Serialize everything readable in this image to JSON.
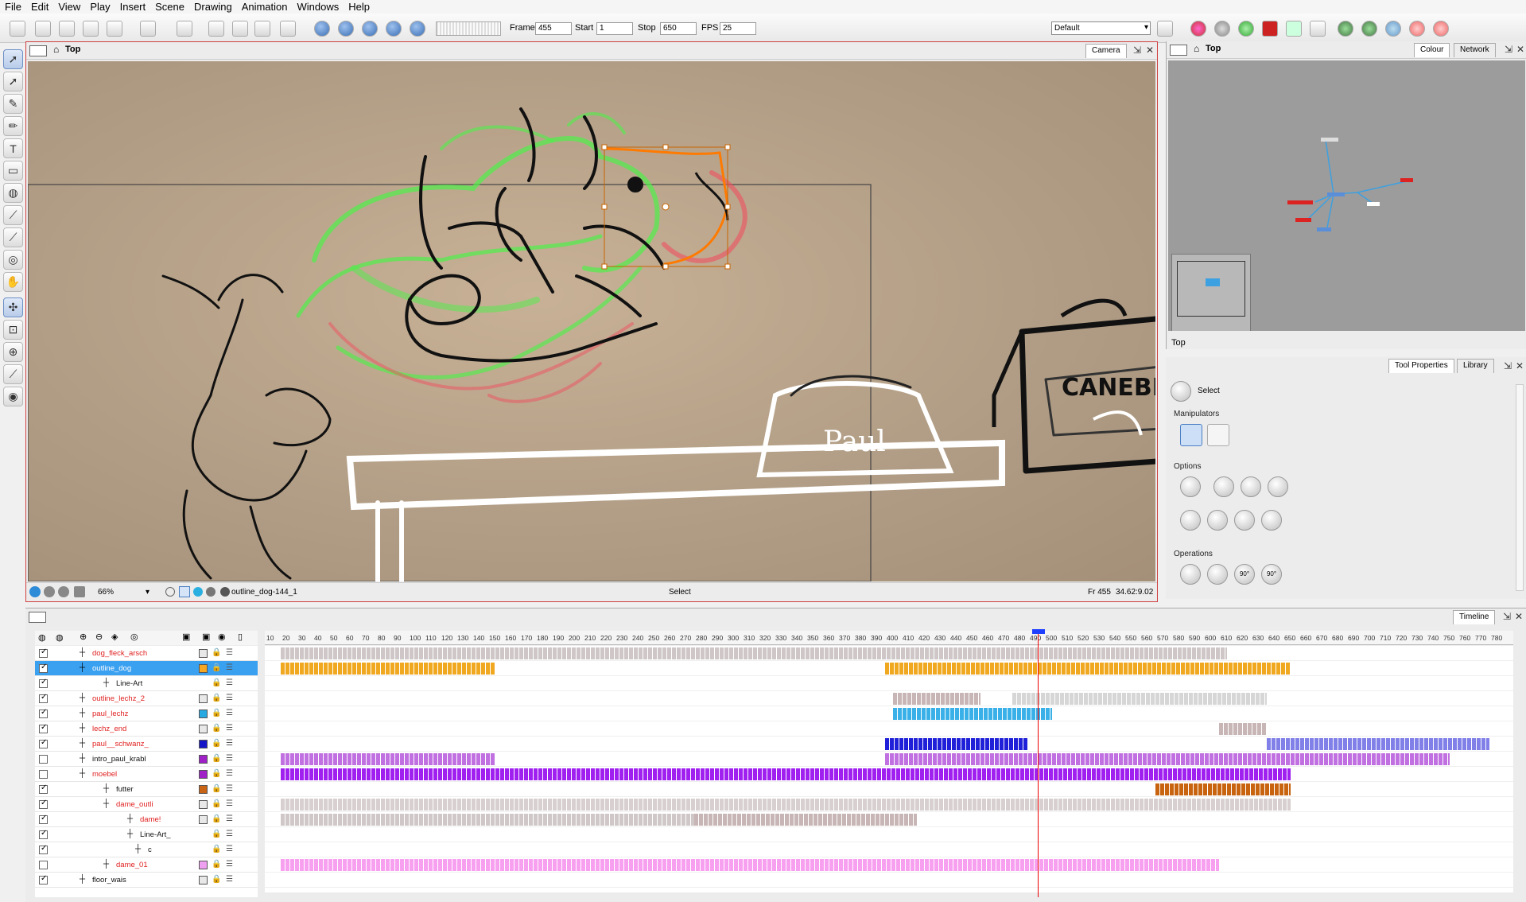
{
  "menu": [
    "File",
    "Edit",
    "View",
    "Play",
    "Insert",
    "Scene",
    "Drawing",
    "Animation",
    "Windows",
    "Help"
  ],
  "toolbar": {
    "frame_label": "Frame",
    "frame_value": "455",
    "start_label": "Start",
    "start_value": "1",
    "stop_label": "Stop",
    "stop_value": "650",
    "fps_label": "FPS",
    "fps_value": "25",
    "workspace": "Default"
  },
  "camera": {
    "view_name": "Top",
    "tab": "Camera",
    "zoom": "66%",
    "drawing_name": "outline_dog-144_1",
    "tool_status": "Select",
    "frame_readout": "Fr 455",
    "coords": "34.62:9.02",
    "box_label": "CANEBIO",
    "bowl_label": "Paul"
  },
  "network": {
    "view_name": "Top",
    "tabs": [
      "Colour",
      "Network"
    ],
    "navigator_label": "Top"
  },
  "tool_properties": {
    "tabs": [
      "Tool Properties",
      "Library"
    ],
    "tool_name": "Select",
    "sections": [
      "Manipulators",
      "Options",
      "Operations"
    ],
    "operation_labels": [
      "90°",
      "90°"
    ]
  },
  "timeline": {
    "tab": "Timeline",
    "ruler": [
      "10",
      "20",
      "30",
      "40",
      "50",
      "60",
      "70",
      "80",
      "90",
      "100",
      "110",
      "120",
      "130",
      "140",
      "150",
      "160",
      "170",
      "180",
      "190",
      "200",
      "210",
      "220",
      "230",
      "240",
      "250",
      "260",
      "270",
      "280",
      "290",
      "300",
      "310",
      "320",
      "330",
      "340",
      "350",
      "360",
      "370",
      "380",
      "390",
      "400",
      "410",
      "420",
      "430",
      "440",
      "450",
      "460",
      "470",
      "480",
      "490",
      "500",
      "510",
      "520",
      "530",
      "540",
      "550",
      "560",
      "570",
      "580",
      "590",
      "600",
      "610",
      "620",
      "630",
      "640",
      "650",
      "660",
      "670",
      "680",
      "690",
      "700",
      "710",
      "720",
      "730",
      "740",
      "750",
      "760",
      "770",
      "780"
    ],
    "layers": [
      {
        "name": "dog_fleck_arsch",
        "color": "#e8e8e8",
        "checked": true,
        "red": true
      },
      {
        "name": "outline_dog",
        "color": "#f5a623",
        "checked": true,
        "red": false
      },
      {
        "name": "Line-Art",
        "color": "",
        "checked": true,
        "red": false
      },
      {
        "name": "outline_lechz_2",
        "color": "#e8e8e8",
        "checked": true,
        "red": true
      },
      {
        "name": "paul_lechz",
        "color": "#27aae1",
        "checked": true,
        "red": true
      },
      {
        "name": "lechz_end",
        "color": "#e8e8e8",
        "checked": true,
        "red": true
      },
      {
        "name": "paul__schwanz_",
        "color": "#1515c8",
        "checked": true,
        "red": true
      },
      {
        "name": "intro_paul_krabl",
        "color": "#a020c8",
        "checked": false,
        "red": false
      },
      {
        "name": "moebel",
        "color": "#a020c8",
        "checked": false,
        "red": true
      },
      {
        "name": "futter",
        "color": "#c86414",
        "checked": true,
        "red": false
      },
      {
        "name": "dame_outli",
        "color": "#e8e8e8",
        "checked": true,
        "red": true
      },
      {
        "name": "dame!",
        "color": "#e8e8e8",
        "checked": true,
        "red": true
      },
      {
        "name": "Line-Art_",
        "color": "",
        "checked": true,
        "red": false
      },
      {
        "name": "c",
        "color": "",
        "checked": true,
        "red": false
      },
      {
        "name": "dame_01",
        "color": "#f0a0f0",
        "checked": false,
        "red": true
      },
      {
        "name": "floor_wais",
        "color": "#e8e8e8",
        "checked": true,
        "red": false
      }
    ]
  }
}
